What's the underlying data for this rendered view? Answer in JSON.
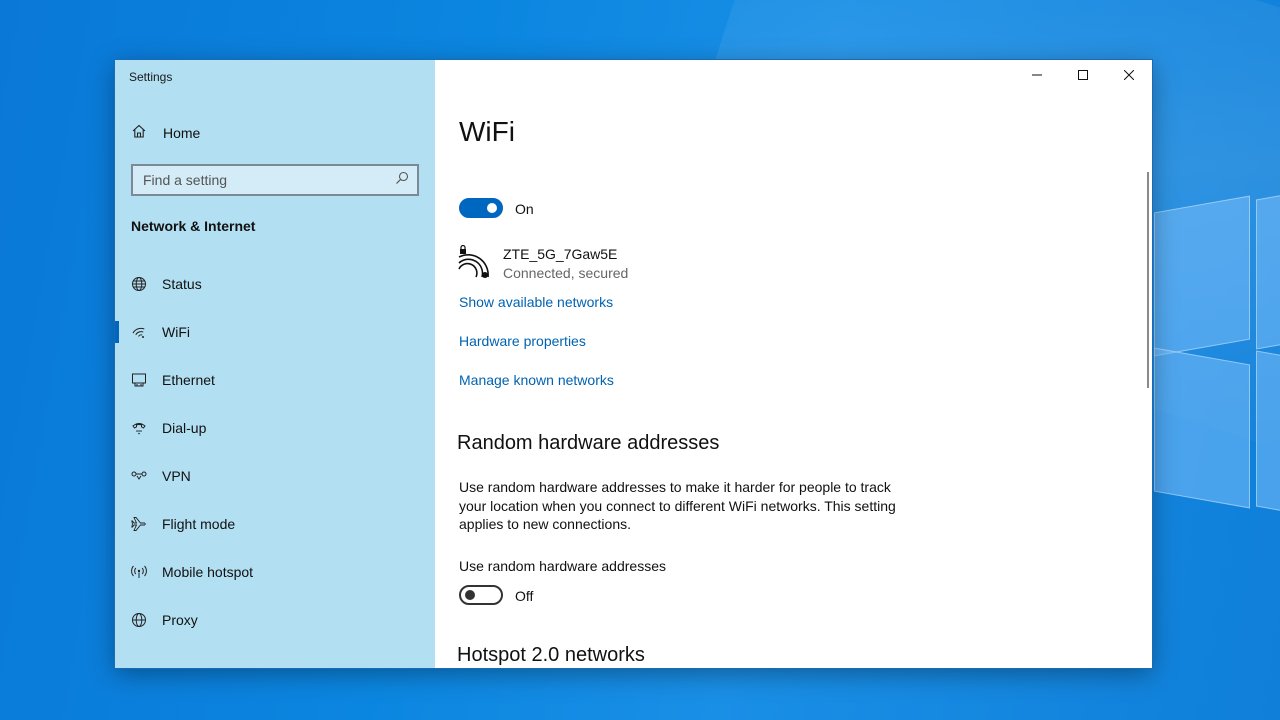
{
  "window": {
    "title": "Settings"
  },
  "sidebar": {
    "home_label": "Home",
    "search_placeholder": "Find a setting",
    "section_title": "Network & Internet",
    "items": [
      {
        "label": "Status",
        "icon": "globe-status-icon"
      },
      {
        "label": "WiFi",
        "icon": "wifi-icon",
        "active": true
      },
      {
        "label": "Ethernet",
        "icon": "ethernet-icon"
      },
      {
        "label": "Dial-up",
        "icon": "dial-up-icon"
      },
      {
        "label": "VPN",
        "icon": "vpn-icon"
      },
      {
        "label": "Flight mode",
        "icon": "airplane-icon"
      },
      {
        "label": "Mobile hotspot",
        "icon": "hotspot-icon"
      },
      {
        "label": "Proxy",
        "icon": "globe-icon"
      }
    ]
  },
  "main": {
    "title": "WiFi",
    "wifi_toggle_state": "On",
    "network": {
      "name": "ZTE_5G_7Gaw5E",
      "status": "Connected, secured"
    },
    "links": {
      "show_networks": "Show available networks",
      "hardware_properties": "Hardware properties",
      "manage_networks": "Manage known networks"
    },
    "random_hw": {
      "heading": "Random hardware addresses",
      "description": "Use random hardware addresses to make it harder for people to track your location when you connect to different WiFi networks. This setting applies to new connections.",
      "toggle_label": "Use random hardware addresses",
      "toggle_state": "Off"
    },
    "hotspot_heading": "Hotspot 2.0 networks"
  },
  "colors": {
    "accent": "#0067c0",
    "link": "#0063b1",
    "sidebar_bg": "#b3dff2"
  }
}
